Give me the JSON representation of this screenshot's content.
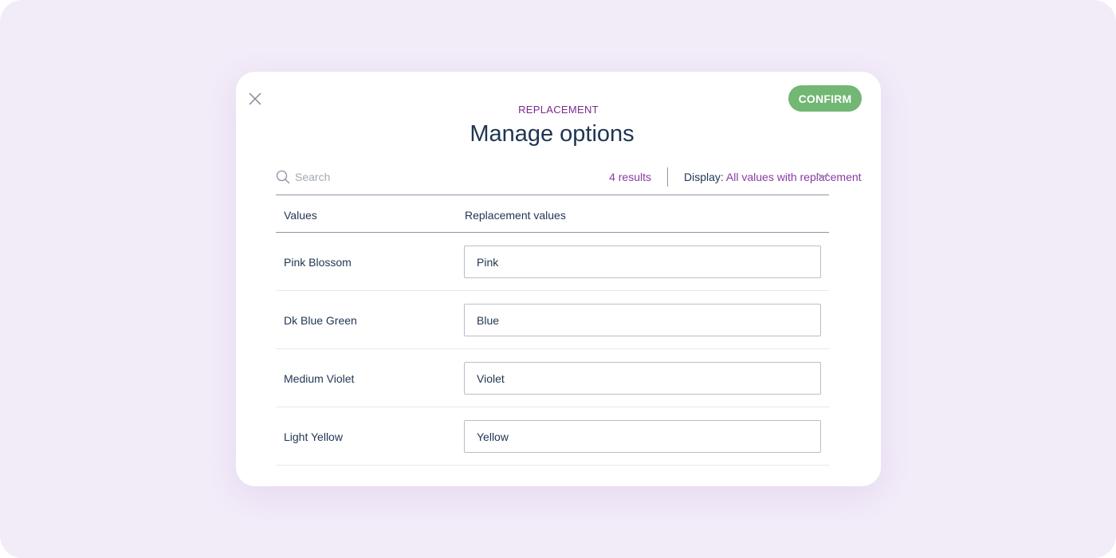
{
  "modal": {
    "eyebrow": "REPLACEMENT",
    "title": "Manage options",
    "confirm_label": "CONFIRM",
    "close_icon": "close-icon"
  },
  "toolbar": {
    "search_placeholder": "Search",
    "search_value": "",
    "results_text": "4 results",
    "display_label": "Display:",
    "display_value": "All values with replacement"
  },
  "table": {
    "columns": [
      "Values",
      "Replacement values"
    ],
    "rows": [
      {
        "value": "Pink Blossom",
        "replacement": "Pink"
      },
      {
        "value": "Dk Blue Green",
        "replacement": "Blue"
      },
      {
        "value": "Medium Violet",
        "replacement": "Violet"
      },
      {
        "value": "Light Yellow",
        "replacement": "Yellow"
      }
    ]
  },
  "colors": {
    "background": "#f2ebf8",
    "accent_purple": "#8a3aa5",
    "confirm_green": "#72b774",
    "text_dark": "#1f3552"
  }
}
